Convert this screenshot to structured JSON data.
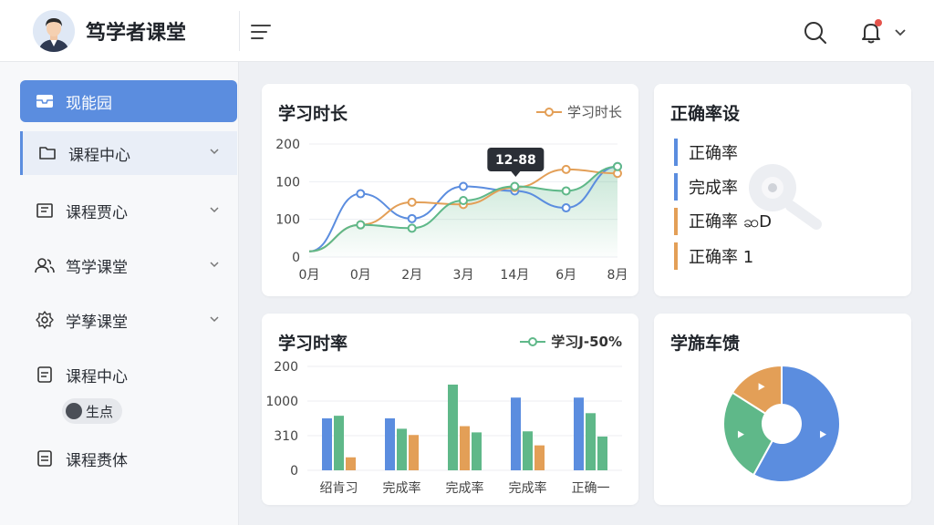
{
  "header": {
    "app_title": "笃学者课堂"
  },
  "sidebar": {
    "items": [
      {
        "label": "现能园"
      },
      {
        "label": "课程中心"
      },
      {
        "label": "课程贾心"
      },
      {
        "label": "笃学课堂"
      },
      {
        "label": "学孳课堂"
      },
      {
        "label": "课程中心"
      },
      {
        "label": "课程赉体"
      }
    ],
    "sub_badge": "生点"
  },
  "colors": {
    "blue": "#5b8ddf",
    "green": "#5fb889",
    "orange": "#e39f57"
  },
  "chart_data": [
    {
      "type": "line",
      "title": "学习时长",
      "legend": "学习时长",
      "x_tick_labels": [
        "0月",
        "0月",
        "2月",
        "3月",
        "14月",
        "6月",
        "8月"
      ],
      "y_tick_labels": [
        "0",
        "100",
        "100",
        "200"
      ],
      "tooltip": "12-88",
      "series": [
        {
          "color": "#5b8ddf",
          "values": [
            10,
            112,
            68,
            125,
            117,
            87,
            160
          ]
        },
        {
          "color": "#e39f57",
          "values": [
            10,
            57,
            97,
            93,
            123,
            155,
            148
          ]
        },
        {
          "color": "#5fb889",
          "values": [
            10,
            57,
            51,
            100,
            125,
            117,
            160
          ]
        }
      ]
    },
    {
      "type": "bar",
      "title": "学习时率",
      "legend": "学习J-50%",
      "categories": [
        "绍肯习",
        "完成率",
        "完成率",
        "完成率",
        "正确一"
      ],
      "y_tick_labels": [
        "0",
        "310",
        "1000",
        "200"
      ],
      "series": [
        {
          "color": "#5b8ddf",
          "values": [
            100,
            100,
            0,
            140,
            140
          ]
        },
        {
          "color": "#5fb889",
          "values": [
            105,
            80,
            165,
            75,
            110
          ]
        },
        {
          "color": "#e39f57",
          "values": [
            25,
            68,
            85,
            48,
            0
          ]
        },
        {
          "color": "#5fb889",
          "values": [
            0,
            0,
            73,
            0,
            65
          ]
        }
      ]
    },
    {
      "type": "pie",
      "title": "学旆车馈",
      "slices": [
        {
          "color": "#5b8ddf",
          "value": 58
        },
        {
          "color": "#5fb889",
          "value": 26
        },
        {
          "color": "#e39f57",
          "value": 16
        }
      ]
    }
  ],
  "status_card": {
    "title": "正确率设",
    "items": [
      {
        "label": "正确率",
        "color": "#5b8ddf"
      },
      {
        "label": "完成率",
        "color": "#5b8ddf"
      },
      {
        "label": "正确率 ဆD",
        "color": "#e39f57"
      },
      {
        "label": "正确率 1",
        "color": "#e39f57"
      }
    ]
  }
}
